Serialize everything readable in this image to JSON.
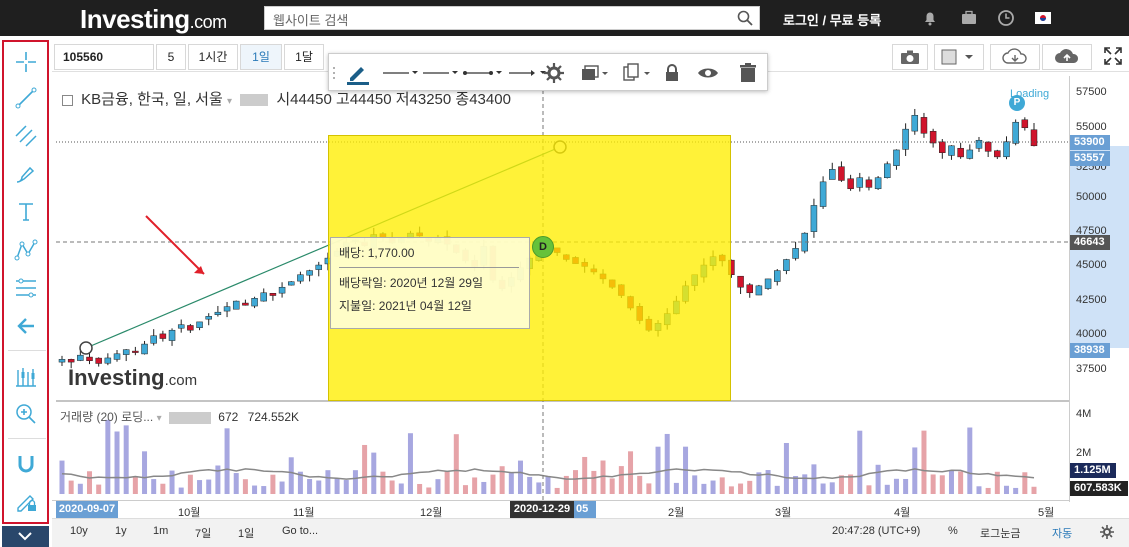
{
  "site": {
    "logo_main": "Investing",
    "logo_suffix": ".com",
    "search_placeholder": "웹사이트 검색",
    "login": "로그인 / 무료 등록"
  },
  "toolbar": {
    "symbol": "105560",
    "interval_5": "5",
    "interval_1h": "1시간",
    "interval_1d": "1일",
    "interval_1m": "1달"
  },
  "legend": {
    "name": "KB금융, 한국, 일, 서울",
    "open": "시44450",
    "high": "고44450",
    "low": "저43250",
    "close": "종43400"
  },
  "loading": "Loading",
  "tooltip": {
    "dividend": "배당: 1,770.00",
    "ex_date": "배당락일: 2020년 12월 29일",
    "pay_date": "지불일: 2021년 04월 12일",
    "marker": "D"
  },
  "watermark": {
    "main": "Investing",
    "suffix": ".com"
  },
  "price_axis": {
    "ticks": [
      "57500",
      "55000",
      "52500",
      "50000",
      "47500",
      "45000",
      "42500",
      "40000",
      "37500"
    ],
    "badge_last": "53900",
    "badge_prev": "53557",
    "badge_cross": "46643",
    "badge_low": "38938",
    "vol_ticks": [
      "4M",
      "2M"
    ],
    "vol_badge_1": "1.125M",
    "vol_badge_2": "607.583K"
  },
  "volume": {
    "title": "거래량 (20) 로딩...",
    "value_1": "672",
    "value_2": "724.552K"
  },
  "time_axis": {
    "start_badge": "2020-09-07",
    "cross_badge": "2020-12-29",
    "cross_suffix": "05",
    "labels": [
      "10월",
      "11월",
      "12월",
      "2월",
      "3월",
      "4월",
      "5월"
    ]
  },
  "bottom": {
    "ranges": [
      "10y",
      "1y",
      "1m",
      "7일",
      "1일"
    ],
    "goto": "Go to...",
    "clock": "20:47:28 (UTC+9)",
    "pct": "%",
    "log": "로그눈금",
    "auto": "자동"
  },
  "colors": {
    "up": "#3fa9d6",
    "down": "#d0142c",
    "highlight": "#fff000",
    "badge_blue": "#6a9fd4"
  },
  "chart_data": {
    "type": "candlestick",
    "x_range": [
      "2020-09-07",
      "2021-05"
    ],
    "y_range": [
      36000,
      58500
    ],
    "last_price": 53900,
    "crosshair_price": 46643,
    "crosshair_date": "2020-12-29",
    "closes": [
      38500,
      38300,
      38800,
      38400,
      38200,
      38600,
      38900,
      39200,
      39000,
      39600,
      40200,
      40000,
      40600,
      41000,
      40600,
      41200,
      41600,
      41900,
      42300,
      42700,
      42400,
      42900,
      43300,
      43100,
      43700,
      44100,
      44600,
      44900,
      45300,
      45800,
      46300,
      46900,
      47100,
      46700,
      47500,
      47300,
      46900,
      47200,
      47600,
      47400,
      47000,
      47300,
      46800,
      46200,
      45600,
      45200,
      46643,
      44200,
      43600,
      44400,
      45100,
      45800,
      46300,
      46700,
      46200,
      45700,
      45400,
      45200,
      44800,
      44300,
      43700,
      43100,
      42200,
      41300,
      40600,
      41100,
      41800,
      42700,
      43800,
      44600,
      45300,
      45900,
      45600,
      44600,
      43700,
      43300,
      43800,
      44300,
      44900,
      45700,
      46500,
      47600,
      49600,
      51300,
      52200,
      51400,
      50800,
      51600,
      50900,
      51600,
      52600,
      53600,
      55100,
      56100,
      54800,
      54100,
      53400,
      53900,
      53100,
      53600,
      54300,
      53500,
      53100,
      54200,
      55600,
      55200,
      53900
    ]
  }
}
